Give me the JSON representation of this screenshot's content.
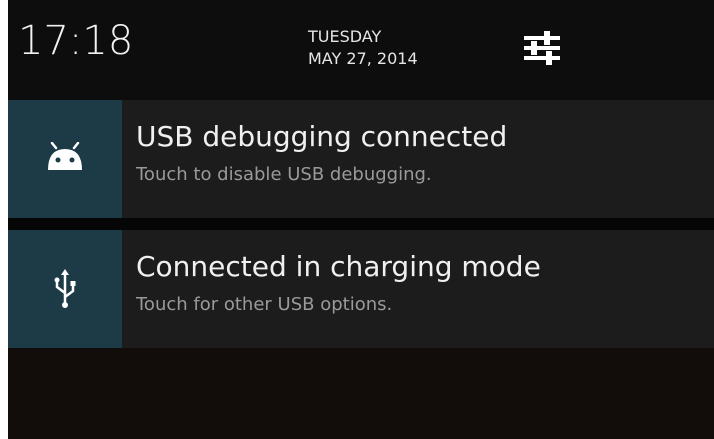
{
  "status_header": {
    "time": "17:18",
    "day": "TUESDAY",
    "date": "MAY 27, 2014",
    "settings_icon": "quick-settings-sliders-icon"
  },
  "notifications": [
    {
      "icon": "android-head-icon",
      "title": "USB debugging connected",
      "text": "Touch to disable USB debugging."
    },
    {
      "icon": "usb-icon",
      "title": "Connected in charging mode",
      "text": "Touch for other USB options."
    }
  ],
  "colors": {
    "background": "#0a0a0a",
    "notification_bg": "#1c1c1c",
    "icon_box_bg": "#1d3a47",
    "title_text": "#f0f0f0",
    "subtitle_text": "#9a9a9a"
  }
}
